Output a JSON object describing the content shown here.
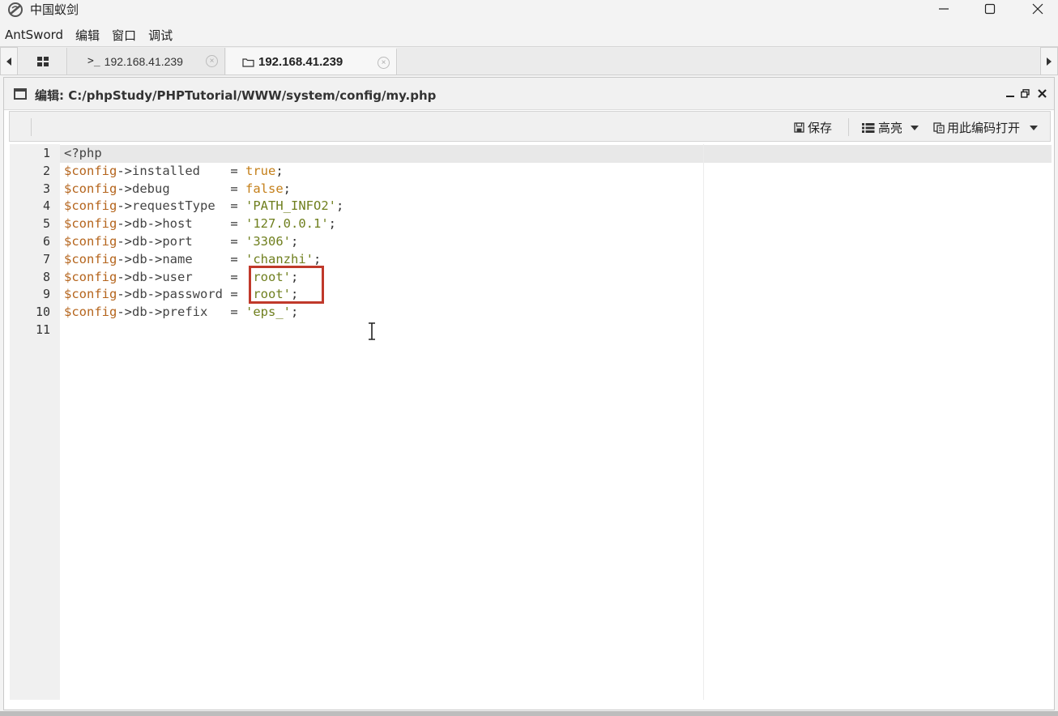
{
  "window": {
    "title": "中国蚁剑",
    "accent": "#c0392b"
  },
  "menu": {
    "items": [
      {
        "label": "AntSword"
      },
      {
        "label": "编辑"
      },
      {
        "label": "窗口"
      },
      {
        "label": "调试"
      }
    ]
  },
  "tabs": {
    "items": [
      {
        "label": "192.168.41.239",
        "icon": "terminal-icon",
        "close": "×"
      },
      {
        "label": "192.168.41.239",
        "icon": "folder-icon",
        "close": "×",
        "active": true
      }
    ]
  },
  "editor": {
    "title": "编辑: C:/phpStudy/PHPTutorial/WWW/system/config/my.php",
    "toolbar": {
      "save_label": "保存",
      "highlight_label": "高亮",
      "encoding_label": "用此编码打开"
    },
    "lines": [
      {
        "n": "1",
        "tokens": [
          {
            "t": "tag",
            "v": "<?php"
          }
        ]
      },
      {
        "n": "2",
        "tokens": [
          {
            "t": "var",
            "v": "$config"
          },
          {
            "t": "op",
            "v": "->"
          },
          {
            "t": "prop",
            "v": "installed    "
          },
          {
            "t": "op",
            "v": "= "
          },
          {
            "t": "kw",
            "v": "true"
          },
          {
            "t": "op",
            "v": ";"
          }
        ]
      },
      {
        "n": "3",
        "tokens": [
          {
            "t": "var",
            "v": "$config"
          },
          {
            "t": "op",
            "v": "->"
          },
          {
            "t": "prop",
            "v": "debug        "
          },
          {
            "t": "op",
            "v": "= "
          },
          {
            "t": "kw",
            "v": "false"
          },
          {
            "t": "op",
            "v": ";"
          }
        ]
      },
      {
        "n": "4",
        "tokens": [
          {
            "t": "var",
            "v": "$config"
          },
          {
            "t": "op",
            "v": "->"
          },
          {
            "t": "prop",
            "v": "requestType  "
          },
          {
            "t": "op",
            "v": "= "
          },
          {
            "t": "str",
            "v": "'PATH_INFO2'"
          },
          {
            "t": "op",
            "v": ";"
          }
        ]
      },
      {
        "n": "5",
        "tokens": [
          {
            "t": "var",
            "v": "$config"
          },
          {
            "t": "op",
            "v": "->"
          },
          {
            "t": "prop",
            "v": "db"
          },
          {
            "t": "op",
            "v": "->"
          },
          {
            "t": "prop",
            "v": "host     "
          },
          {
            "t": "op",
            "v": "= "
          },
          {
            "t": "str",
            "v": "'127.0.0.1'"
          },
          {
            "t": "op",
            "v": ";"
          }
        ]
      },
      {
        "n": "6",
        "tokens": [
          {
            "t": "var",
            "v": "$config"
          },
          {
            "t": "op",
            "v": "->"
          },
          {
            "t": "prop",
            "v": "db"
          },
          {
            "t": "op",
            "v": "->"
          },
          {
            "t": "prop",
            "v": "port     "
          },
          {
            "t": "op",
            "v": "= "
          },
          {
            "t": "str",
            "v": "'3306'"
          },
          {
            "t": "op",
            "v": ";"
          }
        ]
      },
      {
        "n": "7",
        "tokens": [
          {
            "t": "var",
            "v": "$config"
          },
          {
            "t": "op",
            "v": "->"
          },
          {
            "t": "prop",
            "v": "db"
          },
          {
            "t": "op",
            "v": "->"
          },
          {
            "t": "prop",
            "v": "name     "
          },
          {
            "t": "op",
            "v": "= "
          },
          {
            "t": "str",
            "v": "'chanzhi'"
          },
          {
            "t": "op",
            "v": ";"
          }
        ]
      },
      {
        "n": "8",
        "tokens": [
          {
            "t": "var",
            "v": "$config"
          },
          {
            "t": "op",
            "v": "->"
          },
          {
            "t": "prop",
            "v": "db"
          },
          {
            "t": "op",
            "v": "->"
          },
          {
            "t": "prop",
            "v": "user     "
          },
          {
            "t": "op",
            "v": "= "
          },
          {
            "t": "str",
            "v": "'root'"
          },
          {
            "t": "op",
            "v": ";"
          }
        ]
      },
      {
        "n": "9",
        "tokens": [
          {
            "t": "var",
            "v": "$config"
          },
          {
            "t": "op",
            "v": "->"
          },
          {
            "t": "prop",
            "v": "db"
          },
          {
            "t": "op",
            "v": "->"
          },
          {
            "t": "prop",
            "v": "password "
          },
          {
            "t": "op",
            "v": "= "
          },
          {
            "t": "str",
            "v": "'root'"
          },
          {
            "t": "op",
            "v": ";"
          }
        ]
      },
      {
        "n": "10",
        "tokens": [
          {
            "t": "var",
            "v": "$config"
          },
          {
            "t": "op",
            "v": "->"
          },
          {
            "t": "prop",
            "v": "db"
          },
          {
            "t": "op",
            "v": "->"
          },
          {
            "t": "prop",
            "v": "prefix   "
          },
          {
            "t": "op",
            "v": "= "
          },
          {
            "t": "str",
            "v": "'eps_'"
          },
          {
            "t": "op",
            "v": ";"
          }
        ]
      },
      {
        "n": "11",
        "tokens": []
      }
    ]
  }
}
